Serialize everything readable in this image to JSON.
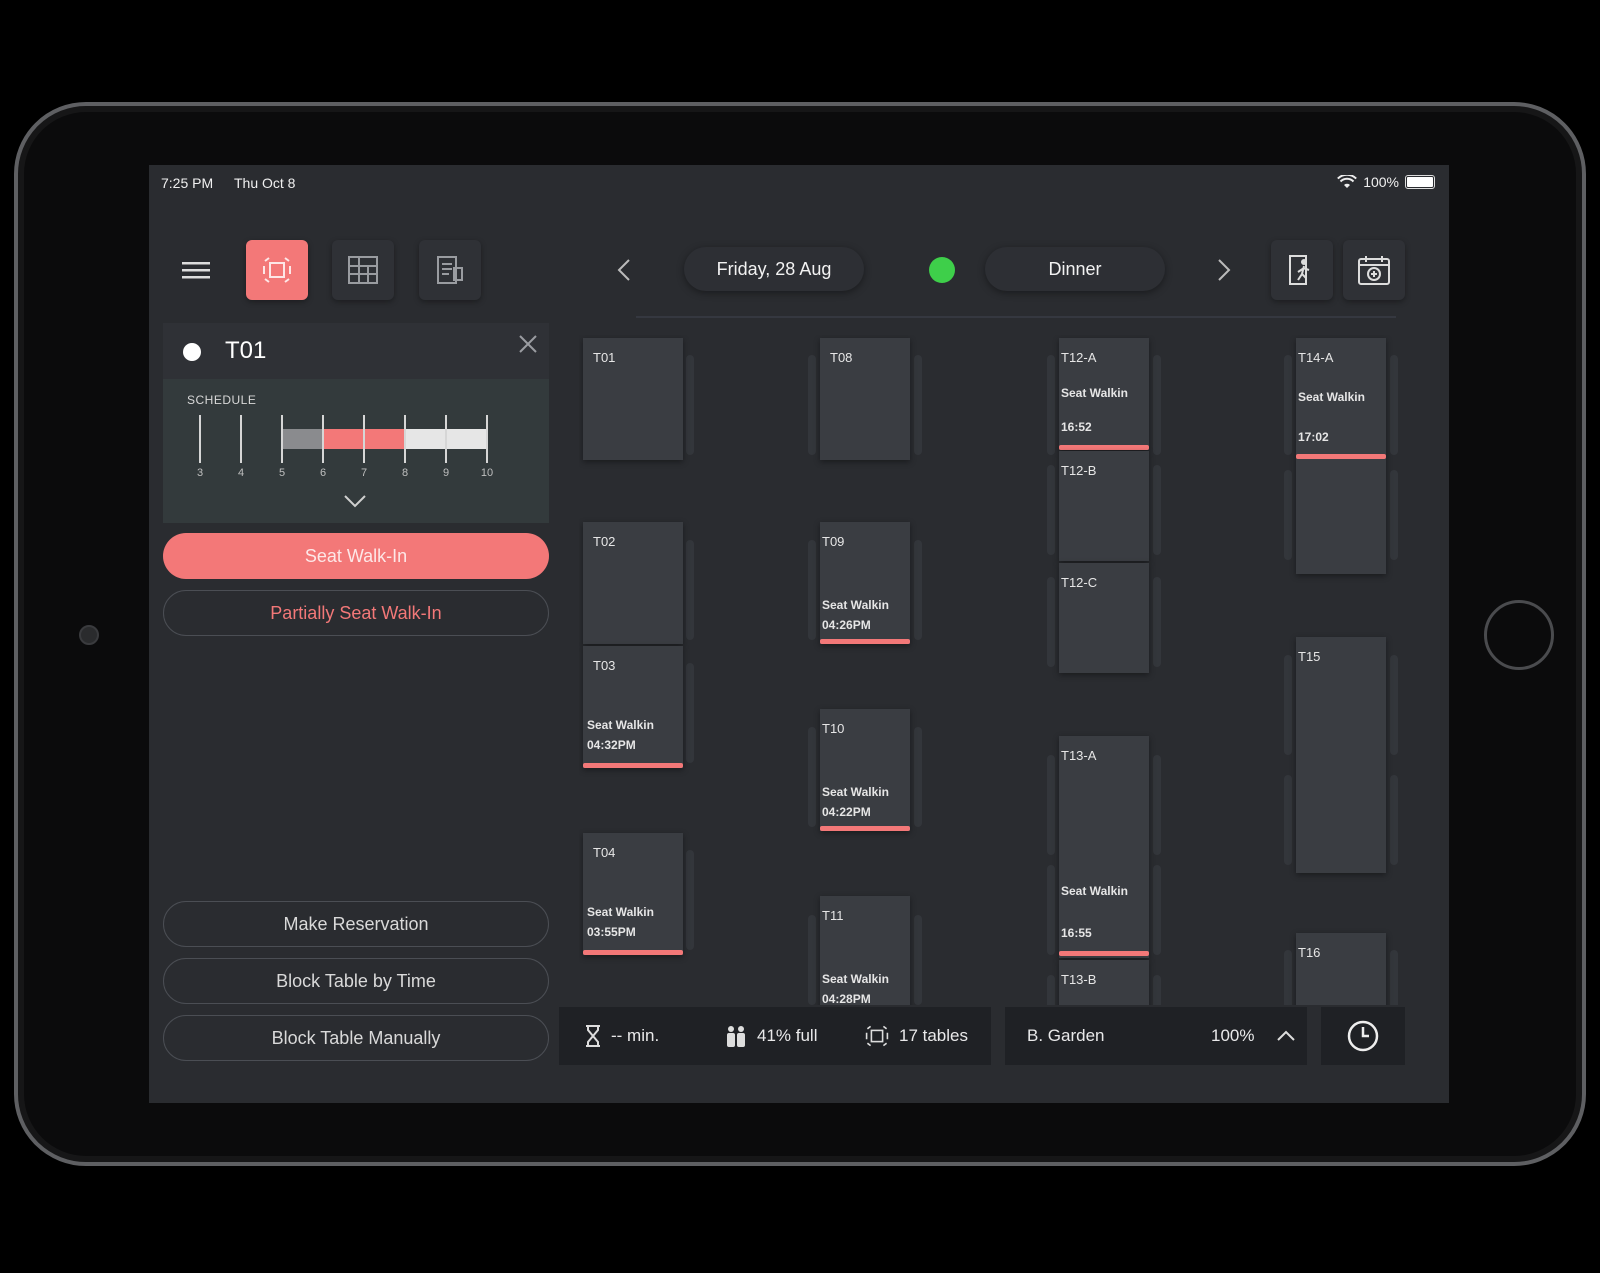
{
  "status": {
    "time": "7:25 PM",
    "date": "Thu Oct 8",
    "battery": "100%"
  },
  "toolbar": {
    "date_label": "Friday, 28 Aug",
    "service_label": "Dinner",
    "online_color": "#3ecf4a",
    "accent": "#f37878"
  },
  "panel": {
    "title": "T01",
    "schedule_label": "SCHEDULE",
    "ticks": [
      "3",
      "4",
      "5",
      "6",
      "7",
      "8",
      "9",
      "10"
    ],
    "seat_walkin": "Seat Walk-In",
    "partial_seat": "Partially Seat Walk-In",
    "make_reservation": "Make Reservation",
    "block_by_time": "Block Table by Time",
    "block_manually": "Block Table Manually"
  },
  "tables": {
    "t01": {
      "name": "T01"
    },
    "t02": {
      "name": "T02"
    },
    "t03": {
      "name": "T03",
      "status": "Seat Walkin",
      "time": "04:32PM"
    },
    "t04": {
      "name": "T04",
      "status": "Seat Walkin",
      "time": "03:55PM"
    },
    "t08": {
      "name": "T08"
    },
    "t09": {
      "name": "T09",
      "status": "Seat Walkin",
      "time": "04:26PM"
    },
    "t10": {
      "name": "T10",
      "status": "Seat Walkin",
      "time": "04:22PM"
    },
    "t11": {
      "name": "T11",
      "status": "Seat Walkin",
      "time": "04:28PM"
    },
    "t12a": {
      "name": "T12-A",
      "status": "Seat Walkin",
      "time": "16:52"
    },
    "t12b": {
      "name": "T12-B"
    },
    "t12c": {
      "name": "T12-C"
    },
    "t13a": {
      "name": "T13-A",
      "status": "Seat Walkin",
      "time": "16:55"
    },
    "t13b": {
      "name": "T13-B"
    },
    "t14a": {
      "name": "T14-A",
      "status": "Seat Walkin",
      "time": "17:02"
    },
    "t15": {
      "name": "T15"
    },
    "t16": {
      "name": "T16"
    }
  },
  "footer": {
    "wait": "-- min.",
    "occupancy": "41% full",
    "tables": "17 tables",
    "area": "B. Garden",
    "zoom": "100%"
  }
}
